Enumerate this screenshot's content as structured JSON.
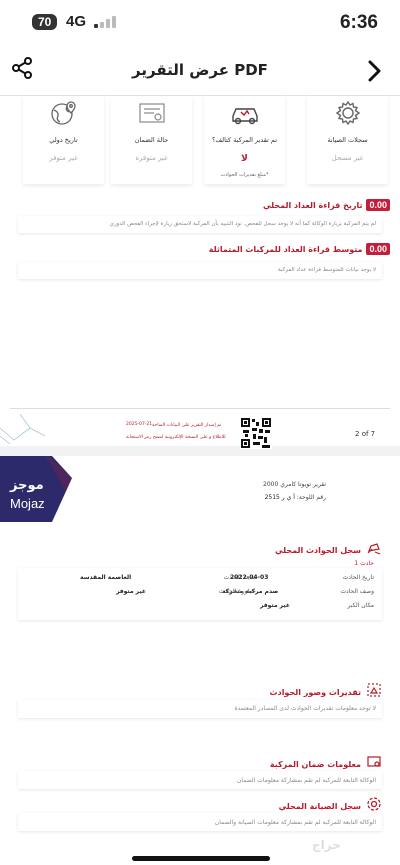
{
  "status_bar": {
    "time": "6:36",
    "battery": "70",
    "network": "4G"
  },
  "nav": {
    "title": "عرض التقرير PDF",
    "back_icon": "chevron-right-icon",
    "share_icon": "share-icon"
  },
  "cards": [
    {
      "title": "سجلات الصيانة",
      "status": "غير مسجل",
      "icon": "gear-icon"
    },
    {
      "title": "تم تقدير المركبة كتالف؟",
      "status": "لا",
      "note": "*مبلغ تقديرات الحوادث",
      "icon": "damaged-car-icon"
    },
    {
      "title": "حالة الضمان",
      "status": "غير متوفرة",
      "icon": "certificate-icon"
    },
    {
      "title": "تاريخ دولي",
      "status": "غير متوفر",
      "icon": "globe-pin-icon"
    }
  ],
  "odometer_local": {
    "title": "تاريخ قراءة العداد المحلي",
    "badge": "0.00",
    "text": "لم يتم المركبة بزيارة الوكالة كما أنه لا يوجد سجل للفحص. نود التنبيه بأن المركبة لاستحق زيارة لإجراء الفحص الدوري"
  },
  "odometer_avg": {
    "title": "متوسط قراءة العداد للمركبات المتماثلة",
    "badge": "0.00",
    "text": "لا يوجد بيانات للمتوسط قراءة عداد المركبة"
  },
  "footer1": {
    "line1": "تم إصدار التقرير على البيانات المتاحة",
    "line2": "للاطلاع و على النسخة الإلكترونية امسح رمز الاستجابة",
    "date": "2025-07-21",
    "page": "2",
    "of": "of 7"
  },
  "report": {
    "logo_ar": "موجز",
    "logo_en": "Mojaz",
    "car_title": "تقرير تويوتا كامري 2000",
    "plate_label": "رقم اللوحة:",
    "plate_value": "أ ي ر 2515"
  },
  "local_accidents": {
    "title": "سجل الحوادث المحلي",
    "accident_label": "حادث 1",
    "fields": [
      {
        "label": "تاريخ الحادث",
        "value": "2022-04-03"
      },
      {
        "label": "مدينة الحادث",
        "value": "العاصمة المقدسة"
      },
      {
        "label": "وصف الحادث",
        "value": "صدم مركبة متحركة"
      },
      {
        "label": "خطورة الحادث",
        "value": "غير متوفر"
      },
      {
        "label": "مكان الكبر",
        "value": "غير متوفر"
      }
    ]
  },
  "accident_photos": {
    "title": "تقديرات وصور الحوادث",
    "text": "لا توجد معلومات تقديرات الحوادث لدى المصادر المعتمدة"
  },
  "warranty_info": {
    "title": "معلومات ضمان المركبة",
    "text": "الوكالة التابعة للمركبة لم تقم بمشاركة معلومات الضمان"
  },
  "local_maintenance": {
    "title": "سجل الصيانة المحلي",
    "text": "الوكالة التابعة للمركبة لم تقم بمشاركة معلومات الصيانة والضمان"
  },
  "colors": {
    "accent": "#b71c2c",
    "badge": "#c41e3a",
    "mojaz_bg": "#2d2a6b"
  }
}
